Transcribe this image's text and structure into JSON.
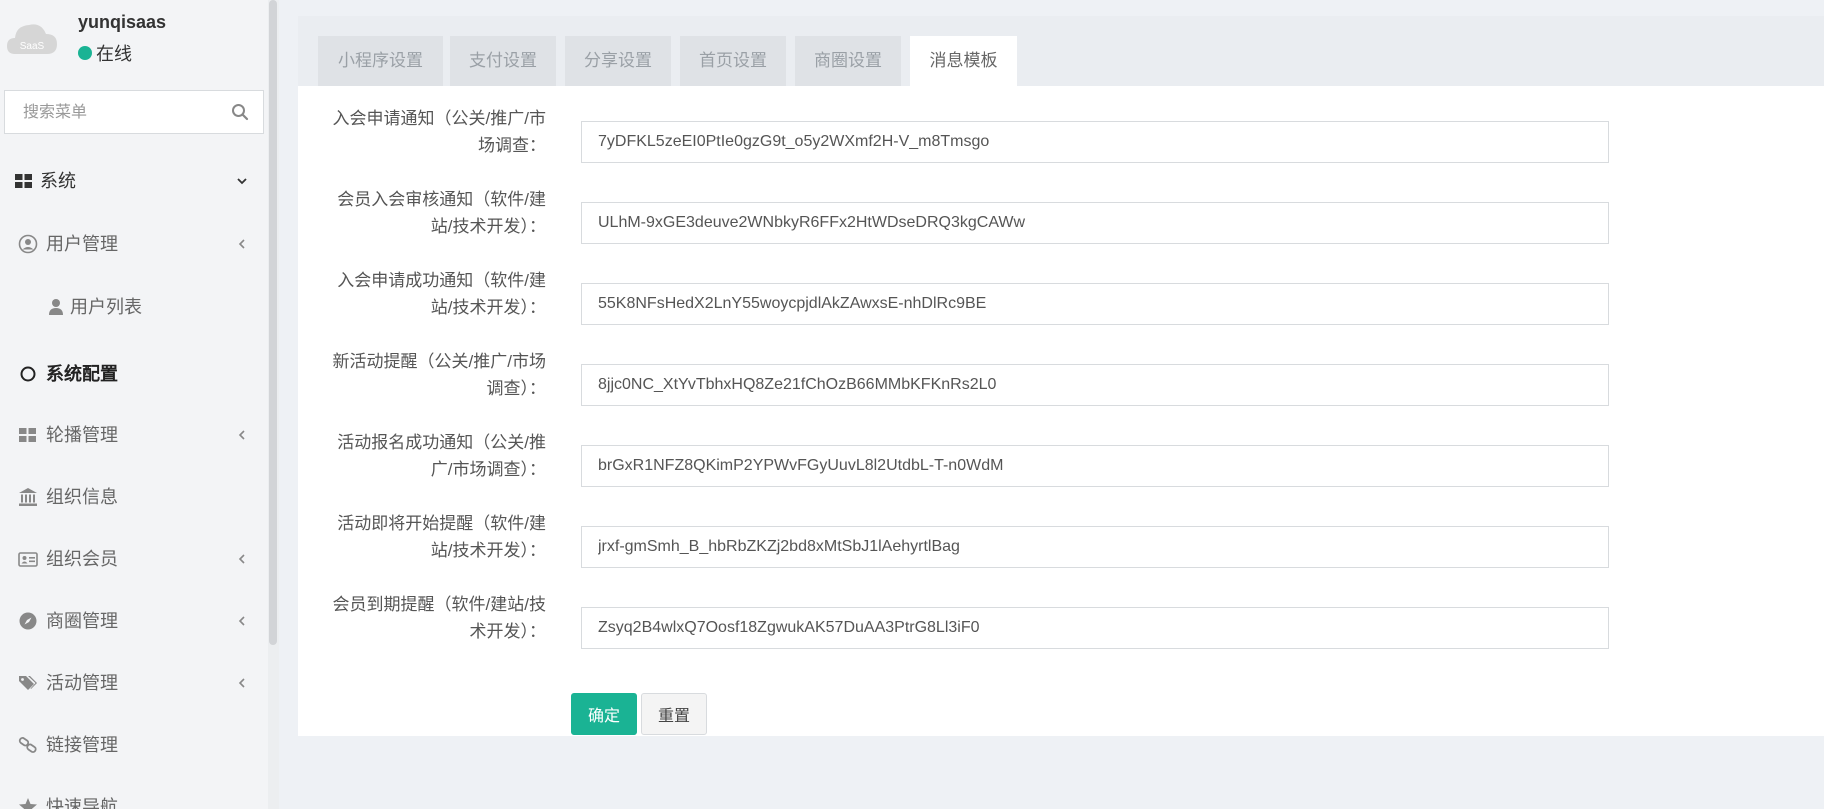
{
  "profile": {
    "name": "yunqisaas",
    "status": "在线",
    "avatar_text": "SaaS"
  },
  "search": {
    "placeholder": "搜索菜单"
  },
  "menu": [
    {
      "label": "系统",
      "icon": "grid-icon",
      "level": "top"
    },
    {
      "label": "用户管理",
      "icon": "user-circle-icon",
      "level": "item"
    },
    {
      "label": "用户列表",
      "icon": "user-icon",
      "level": "sub"
    },
    {
      "label": "系统配置",
      "icon": "circle-icon",
      "level": "item",
      "active": true
    },
    {
      "label": "轮播管理",
      "icon": "grid-icon",
      "level": "item"
    },
    {
      "label": "组织信息",
      "icon": "bank-icon",
      "level": "item"
    },
    {
      "label": "组织会员",
      "icon": "id-card-icon",
      "level": "item"
    },
    {
      "label": "商圈管理",
      "icon": "compass-icon",
      "level": "item"
    },
    {
      "label": "活动管理",
      "icon": "tags-icon",
      "level": "item"
    },
    {
      "label": "链接管理",
      "icon": "link-icon",
      "level": "item"
    },
    {
      "label": "快速导航",
      "icon": "star-icon",
      "level": "item"
    }
  ],
  "tabs": [
    {
      "label": "小程序设置"
    },
    {
      "label": "支付设置"
    },
    {
      "label": "分享设置"
    },
    {
      "label": "首页设置"
    },
    {
      "label": "商圈设置"
    },
    {
      "label": "消息模板",
      "active": true
    }
  ],
  "form": {
    "fields": [
      {
        "label_line1": "入会申请通知（公关/推广/市",
        "label_line2": "场调查：",
        "value": "7yDFKL5zeEI0PtIe0gzG9t_o5y2WXmf2H-V_m8Tmsgo"
      },
      {
        "label_line1": "会员入会审核通知（软件/建",
        "label_line2": "站/技术开发）：",
        "value": "ULhM-9xGE3deuve2WNbkyR6FFx2HtWDseDRQ3kgCAWw"
      },
      {
        "label_line1": "入会申请成功通知（软件/建",
        "label_line2": "站/技术开发）：",
        "value": "55K8NFsHedX2LnY55woycpjdlAkZAwxsE-nhDlRc9BE"
      },
      {
        "label_line1": "新活动提醒（公关/推广/市场",
        "label_line2": "调查）：",
        "value": "8jjc0NC_XtYvTbhxHQ8Ze21fChOzB66MMbKFKnRs2L0"
      },
      {
        "label_line1": "活动报名成功通知（公关/推",
        "label_line2": "广/市场调查）：",
        "value": "brGxR1NFZ8QKimP2YPWvFGyUuvL8l2UtdbL-T-n0WdM"
      },
      {
        "label_line1": "活动即将开始提醒（软件/建",
        "label_line2": "站/技术开发）：",
        "value": "jrxf-gmSmh_B_hbRbZKZj2bd8xMtSbJ1lAehyrtlBag"
      },
      {
        "label_line1": "会员到期提醒（软件/建站/技",
        "label_line2": "术开发）：",
        "value": "Zsyq2B4wlxQ7Oosf18ZgwukAK57DuAA3PtrG8Ll3iF0"
      }
    ],
    "confirm_label": "确定",
    "reset_label": "重置"
  },
  "colors": {
    "accent": "#1ab394",
    "status_online": "#1ab394"
  }
}
